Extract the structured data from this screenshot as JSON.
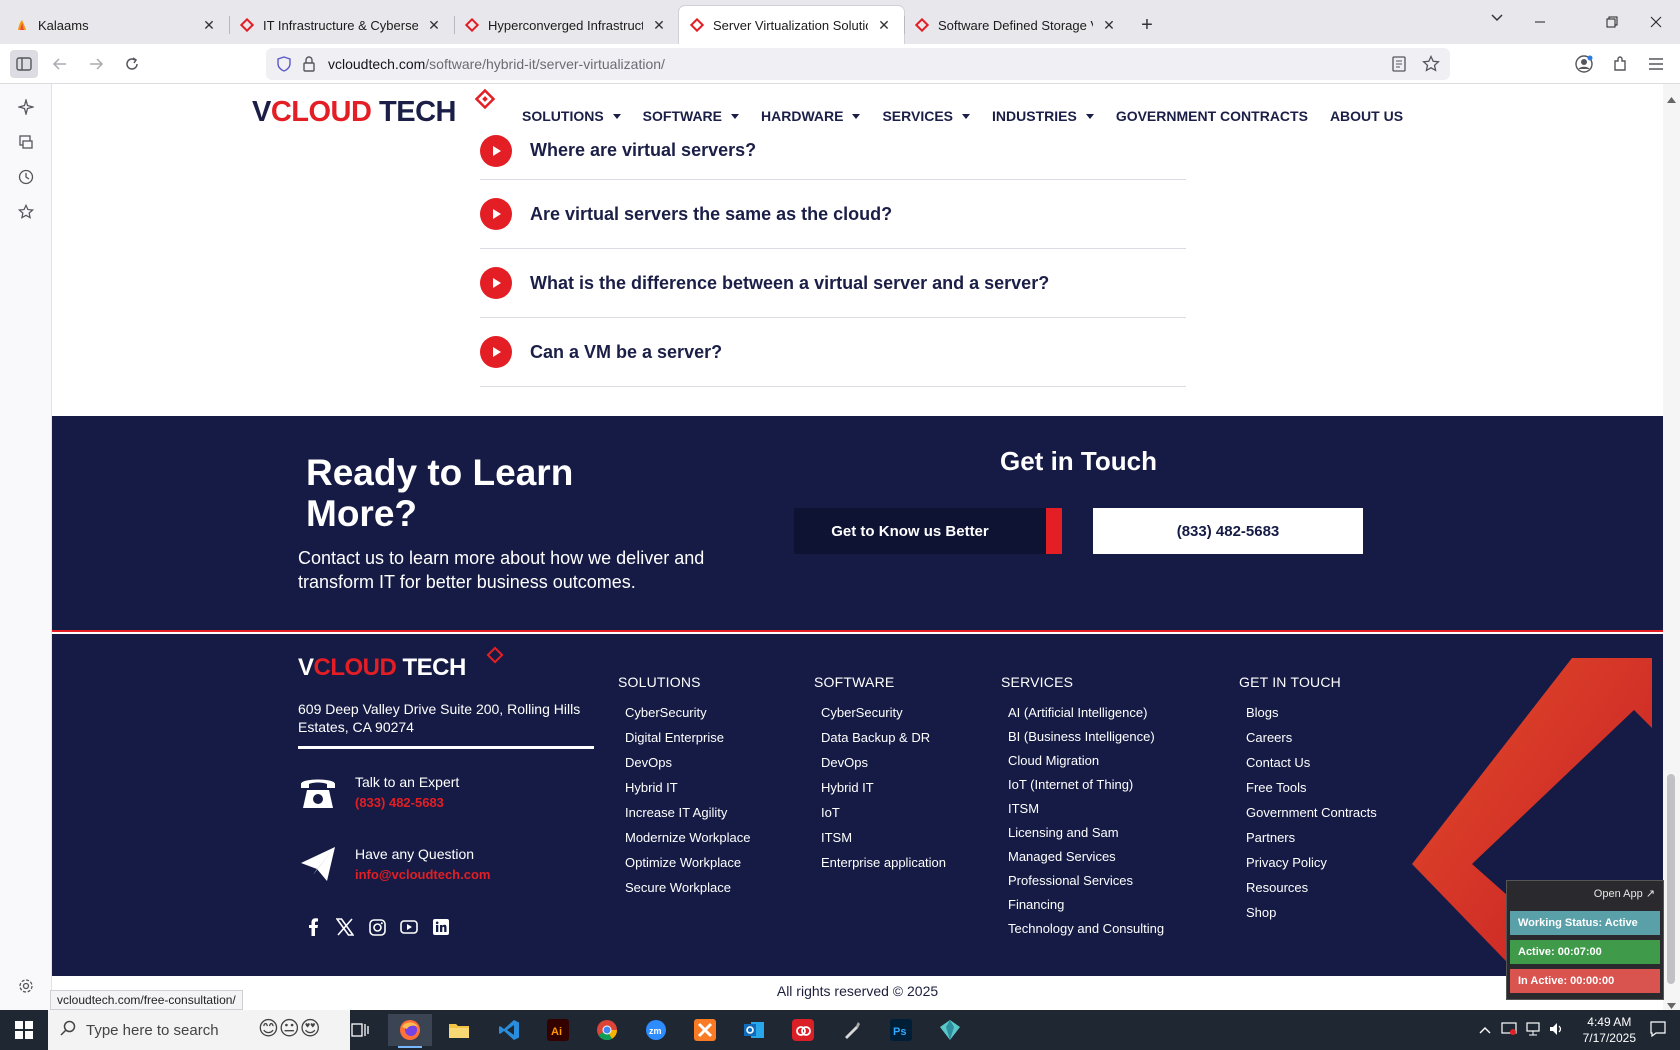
{
  "browser": {
    "tabs": [
      {
        "label": "Kalaams",
        "active": false
      },
      {
        "label": "IT Infrastructure & Cybersecurit",
        "active": false
      },
      {
        "label": "Hyperconverged Infrastructure",
        "active": false
      },
      {
        "label": "Server Virtualization Solutions &",
        "active": true
      },
      {
        "label": "Software Defined Storage Virtu",
        "active": false
      }
    ],
    "new_tab": "+",
    "url_host": "vcloudtech.com",
    "url_path": "/software/hybrid-it/server-virtualization/",
    "status_link": "vcloudtech.com/free-consultation/"
  },
  "site": {
    "logo": {
      "v": "V",
      "cloud": "CLOUD",
      "tech": " TECH"
    },
    "nav": [
      "SOLUTIONS",
      "SOFTWARE",
      "HARDWARE",
      "SERVICES",
      "INDUSTRIES",
      "GOVERNMENT CONTRACTS",
      "ABOUT US"
    ],
    "nav_caret": [
      true,
      true,
      true,
      true,
      true,
      false,
      false
    ],
    "faq": [
      "Where are virtual servers?",
      "Are virtual servers the same as the cloud?",
      "What is the difference between a virtual server and a server?",
      "Can a VM be a server?"
    ],
    "cta": {
      "title": "Ready to Learn More?",
      "subtitle": "Contact us to learn more about how we deliver and transform IT for better business outcomes.",
      "get_in_touch": "Get in Touch",
      "know_button": "Get to Know us Better",
      "phone_button": "(833) 482-5683"
    },
    "footer": {
      "address": "609 Deep Valley Drive Suite 200, Rolling Hills Estates, CA 90274",
      "talk_label": "Talk to an Expert",
      "talk_value": "(833) 482-5683",
      "question_label": "Have any Question",
      "question_value": "info@vcloudtech.com",
      "social": [
        "facebook-icon",
        "x-icon",
        "instagram-icon",
        "youtube-icon",
        "linkedin-icon"
      ],
      "columns": [
        {
          "heading": "SOLUTIONS",
          "items": [
            "CyberSecurity",
            "Digital Enterprise",
            "DevOps",
            "Hybrid IT",
            "Increase IT Agility",
            "Modernize Workplace",
            "Optimize Workplace",
            "Secure Workplace"
          ]
        },
        {
          "heading": "SOFTWARE",
          "items": [
            "CyberSecurity",
            "Data Backup & DR",
            "DevOps",
            "Hybrid IT",
            "IoT",
            "ITSM",
            "Enterprise application"
          ]
        },
        {
          "heading": "SERVICES",
          "items": [
            "AI (Artificial Intelligence)",
            "BI (Business Intelligence)",
            "Cloud Migration",
            "IoT (Internet of Thing)",
            "ITSM",
            "Licensing and Sam",
            "Managed Services",
            "Professional Services",
            "Financing",
            "Technology and Consulting"
          ]
        },
        {
          "heading": "GET IN TOUCH",
          "items": [
            "Blogs",
            "Careers",
            "Contact Us",
            "Free Tools",
            "Government Contracts",
            "Partners",
            "Privacy Policy",
            "Resources",
            "Shop"
          ]
        }
      ],
      "copyright": "All rights reserved © 2025"
    }
  },
  "widget": {
    "open_app": "Open App ↗",
    "working_status": "Working Status: Active",
    "active": "Active: 00:07:00",
    "inactive": "In Active: 00:00:00",
    "colors": {
      "status": "#5aa0a8",
      "active": "#3f9b4a",
      "inactive": "#d9534f"
    }
  },
  "taskbar": {
    "search_placeholder": "Type here to search",
    "time": "4:49 AM",
    "date": "7/17/2025"
  },
  "colors": {
    "brand_navy": "#151b44",
    "brand_red": "#e31e24"
  }
}
